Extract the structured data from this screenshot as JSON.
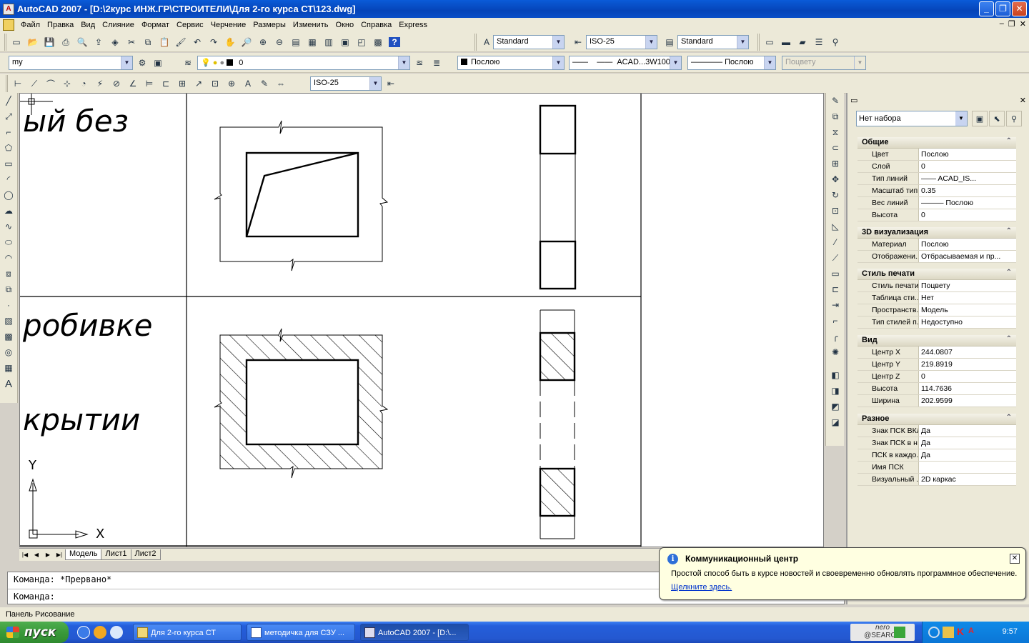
{
  "window": {
    "title": "AutoCAD 2007 - [D:\\2курс ИНЖ.ГР\\СТРОИТЕЛИ\\Для 2-го курса СТ\\123.dwg]"
  },
  "menu": [
    "Файл",
    "Правка",
    "Вид",
    "Слияние",
    "Формат",
    "Сервис",
    "Черчение",
    "Размеры",
    "Изменить",
    "Окно",
    "Справка",
    "Express"
  ],
  "toolbars": {
    "text_style": "Standard",
    "dim_style": "ISO-25",
    "table_style": "Standard",
    "workspace": "my",
    "layer": "0",
    "color": "Послою",
    "linetype": "ACAD...3W100",
    "lineweight": "Послою",
    "plotstyle": "Поцвету",
    "dim_style_2": "ISO-25"
  },
  "drawing": {
    "text_1": "ый без",
    "text_2": "робивке",
    "text_3": "крытии",
    "ucs_x": "X",
    "ucs_y": "Y"
  },
  "layout_tabs": [
    "Модель",
    "Лист1",
    "Лист2"
  ],
  "command": {
    "line1": "Команда: *Прервано*",
    "line2": "Команда:"
  },
  "status": "Панель Рисование",
  "properties": {
    "selection": "Нет набора",
    "sections": [
      {
        "title": "Общие",
        "rows": [
          {
            "k": "Цвет",
            "v": "Послою"
          },
          {
            "k": "Слой",
            "v": "0"
          },
          {
            "k": "Тип линий",
            "v": "—— ACAD_IS..."
          },
          {
            "k": "Масштаб тип...",
            "v": "0.35"
          },
          {
            "k": "Вес линий",
            "v": "——— Послою"
          },
          {
            "k": "Высота",
            "v": "0"
          }
        ]
      },
      {
        "title": "3D визуализация",
        "rows": [
          {
            "k": "Материал",
            "v": "Послою"
          },
          {
            "k": "Отображени...",
            "v": "Отбрасываемая и пр..."
          }
        ]
      },
      {
        "title": "Стиль печати",
        "rows": [
          {
            "k": "Стиль печати",
            "v": "Поцвету"
          },
          {
            "k": "Таблица сти...",
            "v": "Нет"
          },
          {
            "k": "Пространств...",
            "v": "Модель"
          },
          {
            "k": "Тип стилей п...",
            "v": "Недоступно"
          }
        ]
      },
      {
        "title": "Вид",
        "rows": [
          {
            "k": "Центр X",
            "v": "244.0807"
          },
          {
            "k": "Центр Y",
            "v": "219.8919"
          },
          {
            "k": "Центр Z",
            "v": "0"
          },
          {
            "k": "Высота",
            "v": "114.7636"
          },
          {
            "k": "Ширина",
            "v": "202.9599"
          }
        ]
      },
      {
        "title": "Разное",
        "rows": [
          {
            "k": "Знак ПСК ВКЛ",
            "v": "Да"
          },
          {
            "k": "Знак ПСК в н...",
            "v": "Да"
          },
          {
            "k": "ПСК в каждо...",
            "v": "Да"
          },
          {
            "k": "Имя ПСК",
            "v": ""
          },
          {
            "k": "Визуальный ...",
            "v": "2D каркас"
          }
        ]
      }
    ]
  },
  "balloon": {
    "title": "Коммуникационный центр",
    "text": "Простой способ быть в курсе новостей и своевременно обновлять программное обеспечение.",
    "link": "Щелкните здесь."
  },
  "taskbar": {
    "start": "пуск",
    "items": [
      "Для 2-го курса СТ",
      "методичка для СЗУ ...",
      "AutoCAD 2007 - [D:\\..."
    ],
    "tray_brand": "nero",
    "tray_brand_sub": "@SEARCH",
    "clock": "9:57"
  }
}
